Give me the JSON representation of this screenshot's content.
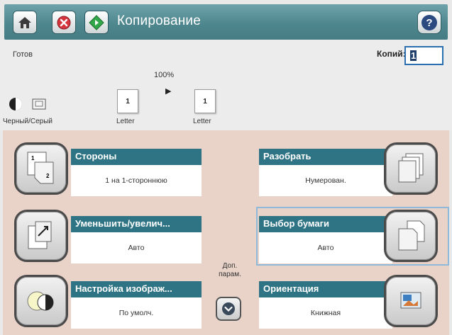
{
  "header": {
    "title": "Копирование",
    "icons": [
      "home-icon",
      "stop-icon",
      "start-icon",
      "help-icon"
    ]
  },
  "status": {
    "state": "Готов",
    "copies_label": "Копий:",
    "copies_value": "1"
  },
  "preview": {
    "zoom": "100%",
    "source_page_number": "1",
    "dest_page_number": "1",
    "source_paper": "Letter",
    "dest_paper": "Letter",
    "color_mode": "Черный/Серый"
  },
  "tiles": {
    "sides": {
      "title": "Стороны",
      "value": "1 на 1-стороннюю"
    },
    "reduce": {
      "title": "Уменьшить/увелич...",
      "value": "Авто"
    },
    "image": {
      "title": "Настройка изображ...",
      "value": "По умолч."
    },
    "collate": {
      "title": "Разобрать",
      "value": "Нумерован."
    },
    "paper": {
      "title": "Выбор бумаги",
      "value": "Авто"
    },
    "orientation": {
      "title": "Ориентация",
      "value": "Книжная"
    }
  },
  "more_options": {
    "label": "Доп. парам."
  },
  "colors": {
    "header_gradient": "#4f878f",
    "tile_header": "#2f7485",
    "tile_area_bg": "#e9d3c8",
    "selected_frame": "#8fb9d8"
  }
}
